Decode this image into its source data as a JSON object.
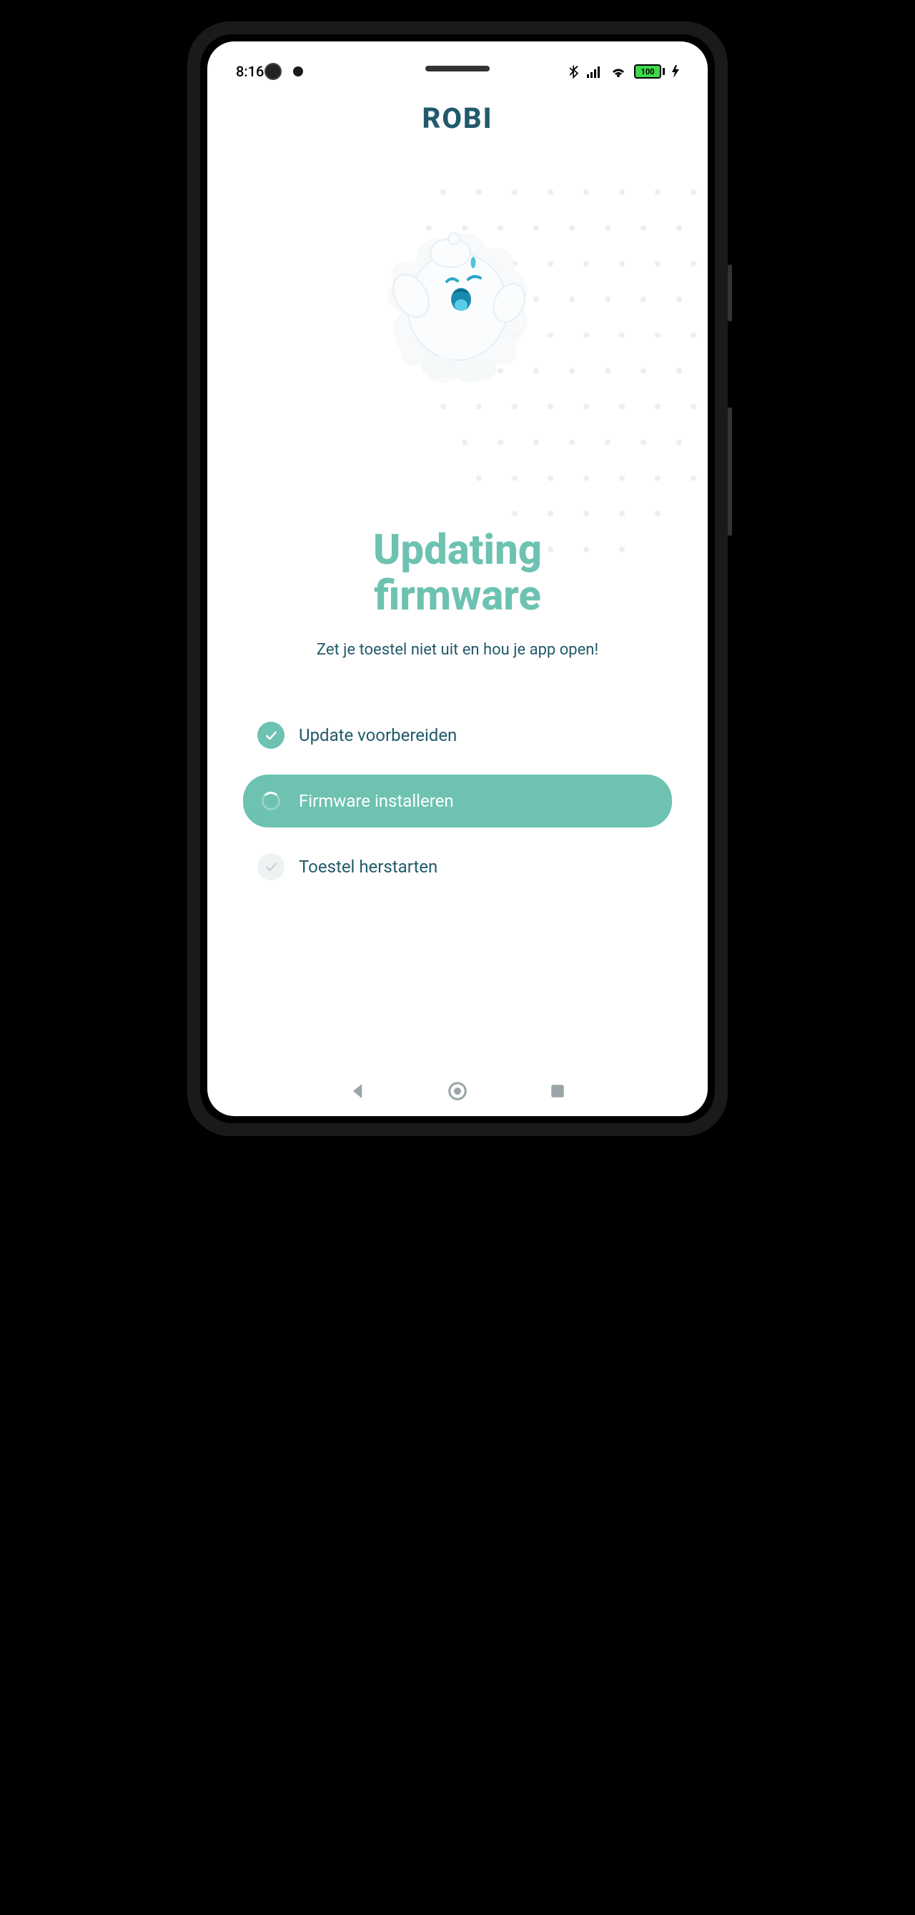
{
  "status_bar": {
    "time": "8:16",
    "battery_level": "100"
  },
  "app": {
    "logo_text": "ROBI"
  },
  "main": {
    "title_line1": "Updating",
    "title_line2": "firmware",
    "subtitle": "Zet je toestel niet uit en hou je app open!"
  },
  "steps": [
    {
      "label": "Update voorbereiden",
      "state": "done"
    },
    {
      "label": "Firmware installeren",
      "state": "active"
    },
    {
      "label": "Toestel herstarten",
      "state": "pending"
    }
  ]
}
